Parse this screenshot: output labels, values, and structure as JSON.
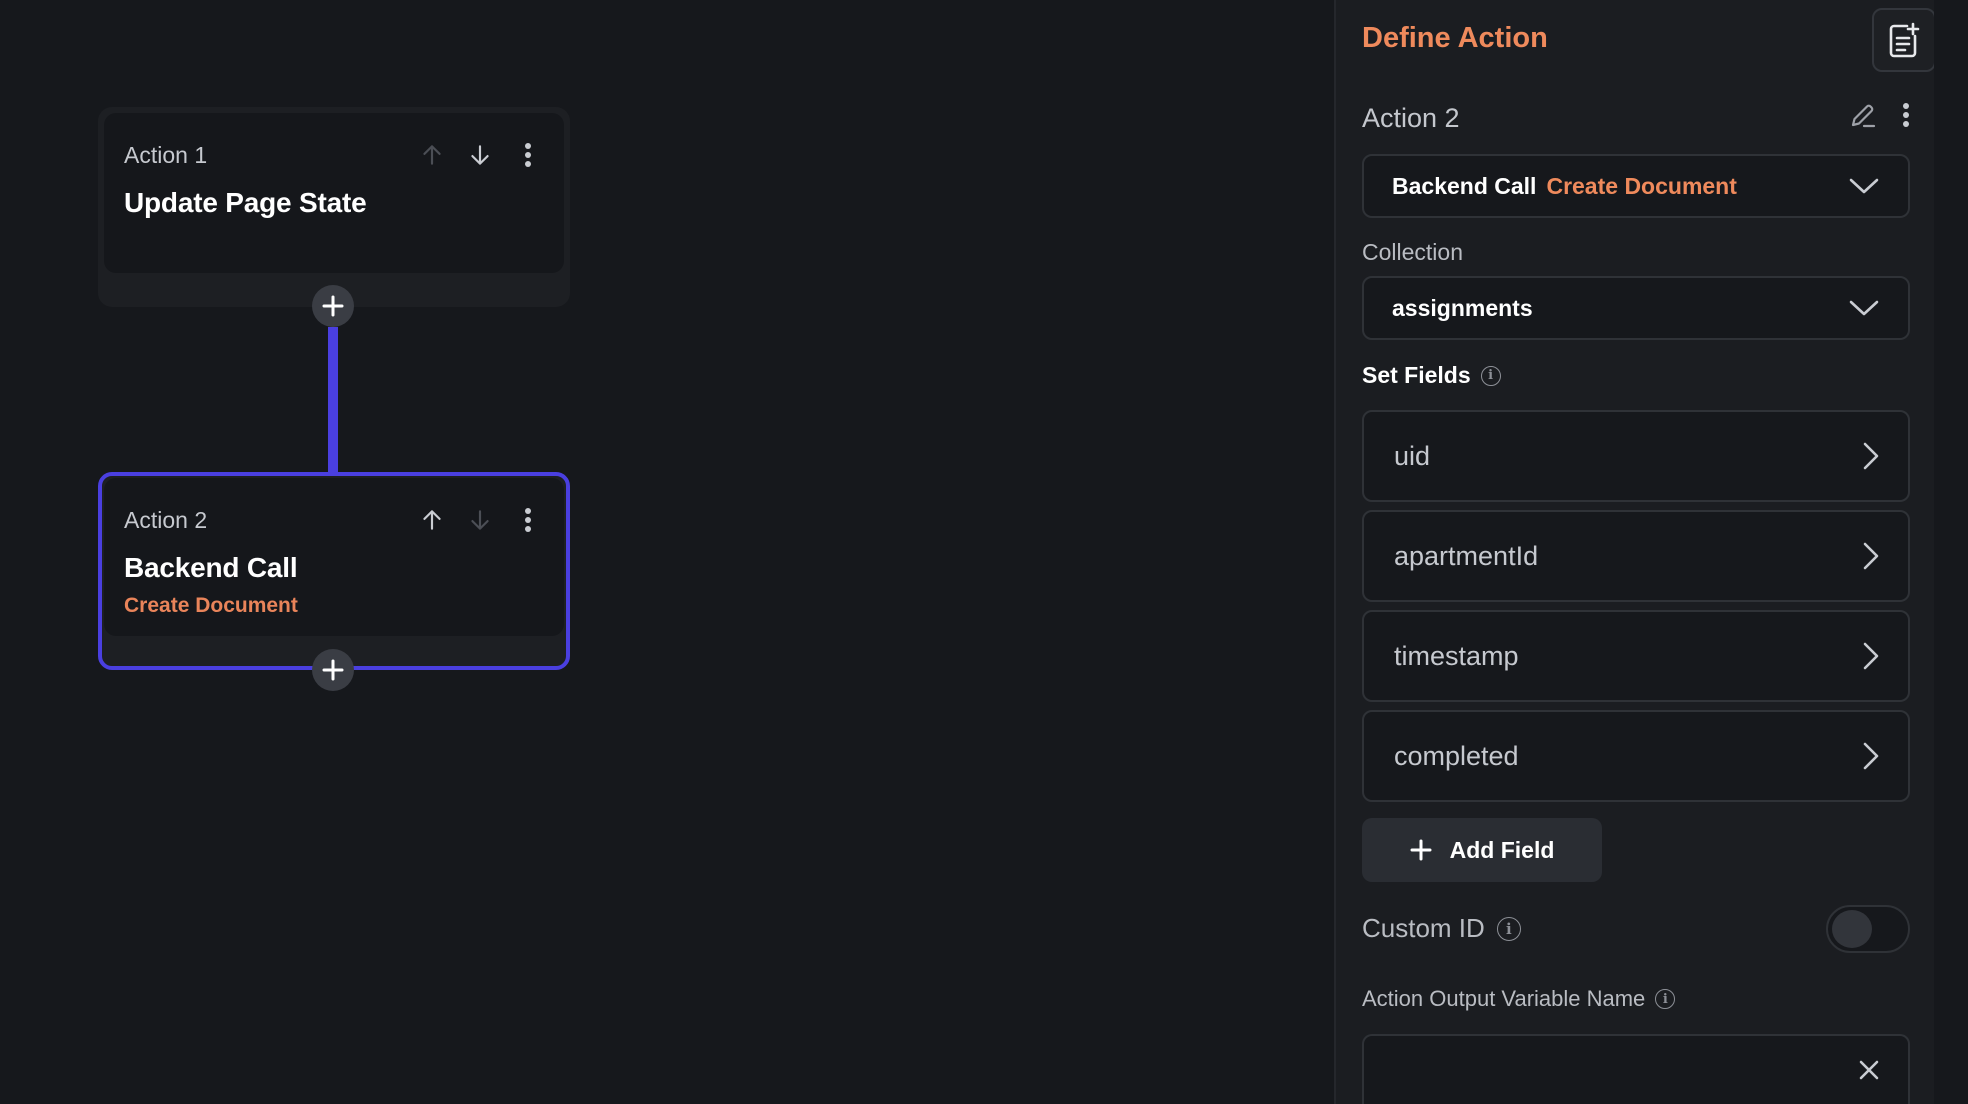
{
  "canvas": {
    "actions": [
      {
        "number_label": "Action 1",
        "title": "Update Page State",
        "subtitle": ""
      },
      {
        "number_label": "Action 2",
        "title": "Backend Call",
        "subtitle": "Create Document"
      }
    ]
  },
  "panel": {
    "title": "Define Action",
    "action_name": "Action 2",
    "action_type": {
      "main": "Backend Call",
      "sub": "Create Document"
    },
    "collection_label": "Collection",
    "collection_value": "assignments",
    "set_fields_label": "Set Fields",
    "fields": [
      "uid",
      "apartmentId",
      "timestamp",
      "completed"
    ],
    "add_field_label": "Add Field",
    "custom_id_label": "Custom ID",
    "custom_id_enabled": false,
    "output_var_label": "Action Output Variable Name",
    "output_var_value": "",
    "info_glyph": "i"
  },
  "colors": {
    "accent_orange": "#ef8a5c",
    "selection_blue": "#4a3fe0",
    "background": "#16181c"
  },
  "icons": [
    "arrow-up-icon",
    "arrow-down-icon",
    "more-vertical-icon",
    "plus-icon",
    "add-note-icon",
    "edit-pencil-icon",
    "chevron-down-icon",
    "chevron-right-icon",
    "info-icon",
    "clear-x-icon"
  ]
}
